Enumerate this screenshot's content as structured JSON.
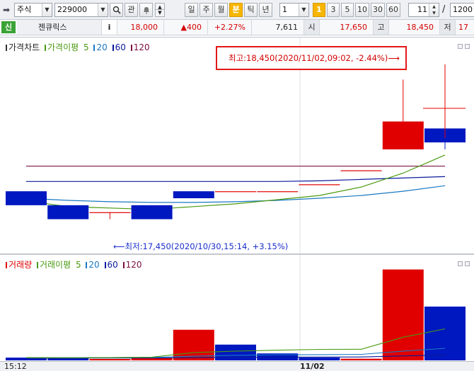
{
  "toolbar": {
    "market_type": "주식",
    "stock_code": "229000",
    "search_icon": "search-icon",
    "watchlist_label": "관",
    "period_buttons": [
      "일",
      "주",
      "월",
      "분",
      "틱",
      "년"
    ],
    "active_period": "분",
    "interval_value": "1",
    "interval_presets": [
      "1",
      "3",
      "5",
      "10",
      "30",
      "60"
    ],
    "active_preset": "1",
    "zoom_value": "11",
    "separator": "/",
    "total_value": "1200"
  },
  "quote": {
    "credit_badge": "신",
    "stock_name": "젠큐릭스",
    "info_label": "i",
    "price": "18,000",
    "change": "▲400",
    "change_pct": "+2.27%",
    "volume": "7,611",
    "open_label": "시",
    "open_value": "17,650",
    "high_label": "고",
    "high_value": "18,450",
    "low_label": "저",
    "low_value_partial": "17"
  },
  "price_pane": {
    "legend": {
      "chart_name": "가격차트",
      "ma_name": "가격이평",
      "periods": [
        "5",
        "20",
        "60",
        "120"
      ]
    },
    "high_annotation": "최고:18,450(2020/11/02,09:02, -2.44%)⟶",
    "low_annotation": "⟵최저:17,450(2020/10/30,15:14, +3.15%)"
  },
  "volume_pane": {
    "legend": {
      "chart_name": "거래량",
      "ma_name": "거래이평",
      "periods": [
        "20",
        "60",
        "120"
      ],
      "first_period": "5"
    }
  },
  "xaxis": {
    "start_label": "15:12",
    "date_label": "11/02"
  },
  "colors": {
    "up": "#e00000",
    "down": "#0018c0",
    "ma5": "#4a9a10",
    "ma20": "#1a78c2",
    "ma60": "#0a1a9a",
    "ma120": "#7a1040"
  },
  "chart_data": {
    "type": "candlestick",
    "price_range": [
      17250,
      18650
    ],
    "candles": [
      {
        "open": 17650,
        "high": 17650,
        "low": 17550,
        "close": 17550
      },
      {
        "open": 17550,
        "high": 17550,
        "low": 17450,
        "close": 17450
      },
      {
        "open": 17500,
        "high": 17500,
        "low": 17450,
        "close": 17500
      },
      {
        "open": 17550,
        "high": 17550,
        "low": 17450,
        "close": 17450
      },
      {
        "open": 17650,
        "high": 17650,
        "low": 17600,
        "close": 17600
      },
      {
        "open": 17650,
        "high": 17650,
        "low": 17650,
        "close": 17650
      },
      {
        "open": 17650,
        "high": 17650,
        "low": 17650,
        "close": 17650
      },
      {
        "open": 17700,
        "high": 17700,
        "low": 17700,
        "close": 17700
      },
      {
        "open": 17800,
        "high": 17800,
        "low": 17800,
        "close": 17800
      },
      {
        "open": 17950,
        "high": 18450,
        "low": 17950,
        "close": 18150
      },
      {
        "open": 18100,
        "high": 18350,
        "low": 17950,
        "close": 18000
      }
    ],
    "ma": {
      "5": [
        17580,
        17540,
        17530,
        17520,
        17540,
        17560,
        17590,
        17620,
        17680,
        17780,
        17910
      ],
      "20": [
        17600,
        17585,
        17575,
        17570,
        17570,
        17575,
        17585,
        17600,
        17620,
        17650,
        17690
      ],
      "60": [
        17720,
        17720,
        17720,
        17720,
        17720,
        17720,
        17720,
        17725,
        17735,
        17745,
        17755
      ],
      "120": [
        17830,
        17830,
        17830,
        17830,
        17830,
        17830,
        17830,
        17830,
        17830,
        17830,
        17830
      ]
    },
    "volume": {
      "range": [
        0,
        1000
      ],
      "values": [
        30,
        25,
        15,
        30,
        330,
        170,
        75,
        30,
        18,
        980,
        580
      ],
      "direction": [
        "down",
        "down",
        "up",
        "up",
        "up",
        "down",
        "down",
        "down",
        "up",
        "up",
        "down"
      ],
      "ma": {
        "5": [
          30,
          28,
          30,
          35,
          85,
          100,
          110,
          118,
          120,
          250,
          340
        ],
        "20": [
          30,
          30,
          30,
          32,
          45,
          55,
          60,
          62,
          65,
          100,
          130
        ],
        "60": [
          25,
          25,
          25,
          26,
          30,
          33,
          35,
          36,
          37,
          48,
          58
        ]
      }
    }
  }
}
